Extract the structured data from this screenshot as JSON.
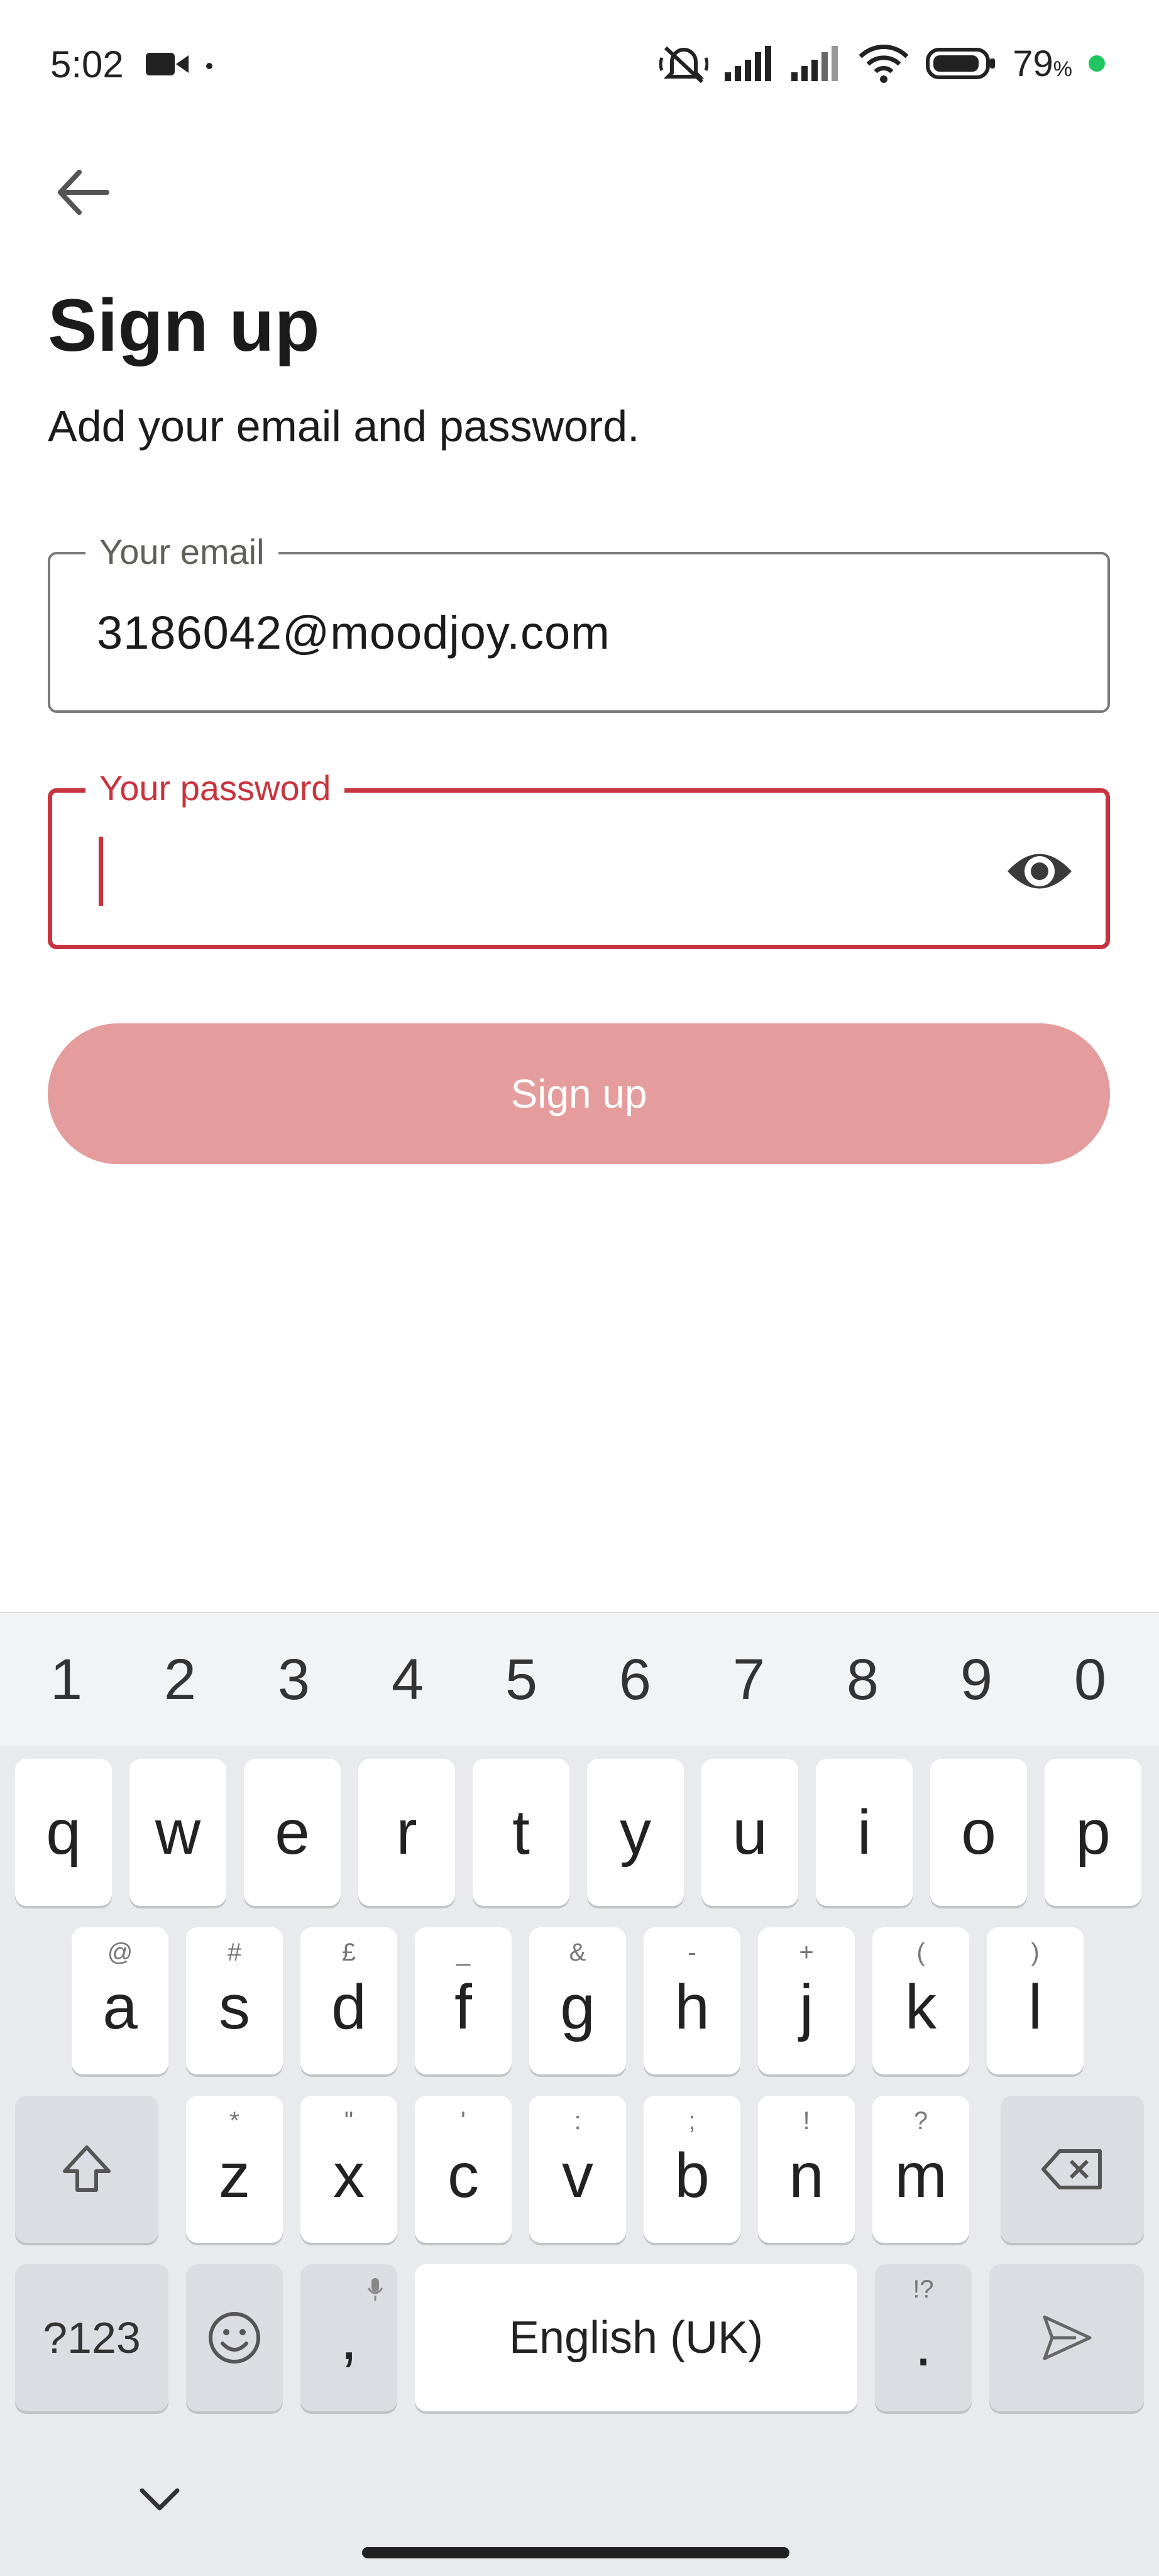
{
  "status_bar": {
    "time": "5:02",
    "battery": "79",
    "battery_unit": "%",
    "icons": [
      "video-camera-icon",
      "notifications-muted-icon",
      "signal-icon",
      "signal-icon",
      "wifi-icon",
      "battery-icon"
    ]
  },
  "page": {
    "title": "Sign up",
    "subtitle": "Add your email and password."
  },
  "form": {
    "email": {
      "label": "Your email",
      "value": "3186042@moodjoy.com"
    },
    "password": {
      "label": "Your password",
      "value": ""
    },
    "submit_label": "Sign up"
  },
  "colors": {
    "accent": "#c8333d",
    "button_disabled": "#e59c9c"
  },
  "keyboard": {
    "numbers": [
      "1",
      "2",
      "3",
      "4",
      "5",
      "6",
      "7",
      "8",
      "9",
      "0"
    ],
    "row1": [
      "q",
      "w",
      "e",
      "r",
      "t",
      "y",
      "u",
      "i",
      "o",
      "p"
    ],
    "row2": [
      {
        "key": "a",
        "hint": "@"
      },
      {
        "key": "s",
        "hint": "#"
      },
      {
        "key": "d",
        "hint": "£"
      },
      {
        "key": "f",
        "hint": "_"
      },
      {
        "key": "g",
        "hint": "&"
      },
      {
        "key": "h",
        "hint": "-"
      },
      {
        "key": "j",
        "hint": "+"
      },
      {
        "key": "k",
        "hint": "("
      },
      {
        "key": "l",
        "hint": ")"
      }
    ],
    "row3": [
      {
        "key": "z",
        "hint": "*"
      },
      {
        "key": "x",
        "hint": "\""
      },
      {
        "key": "c",
        "hint": "'"
      },
      {
        "key": "v",
        "hint": ":"
      },
      {
        "key": "b",
        "hint": ";"
      },
      {
        "key": "n",
        "hint": "!"
      },
      {
        "key": "m",
        "hint": "?"
      }
    ],
    "symbols_label": "?123",
    "comma": ",",
    "space_label": "English (UK)",
    "period": ".",
    "period_hint": "!?"
  }
}
